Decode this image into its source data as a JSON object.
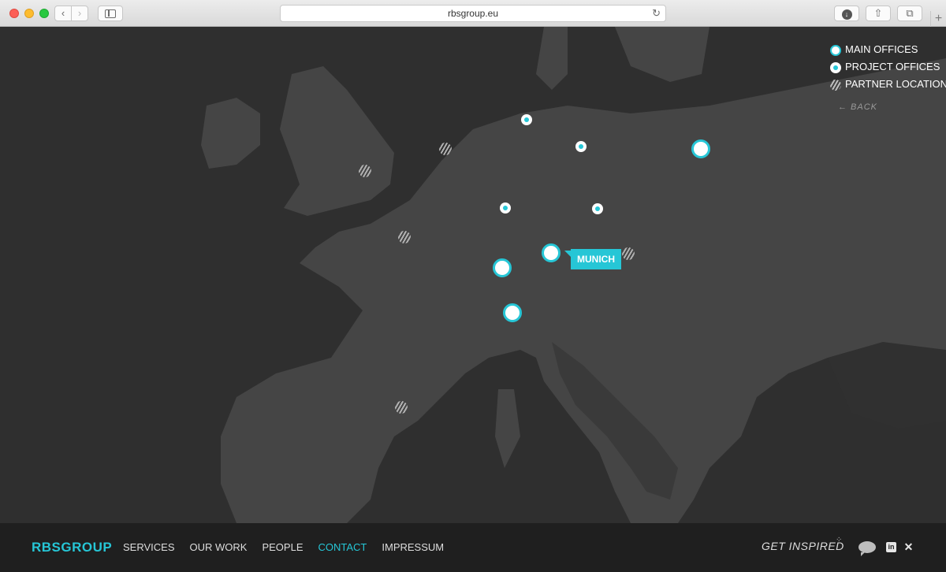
{
  "browser": {
    "url": "rbsgroup.eu",
    "back_glyph": "‹",
    "forward_glyph": "›",
    "reload_glyph": "↻",
    "share_glyph": "⇧",
    "tabs_glyph": "⧉",
    "newtab_glyph": "+"
  },
  "map": {
    "legend": {
      "main_offices": "MAIN OFFICES",
      "project_offices": "PROJECT OFFICES",
      "partner_locations": "PARTNER LOCATIONS"
    },
    "back_label": "← BACK",
    "selected_tooltip": "MUNICH",
    "colors": {
      "accent": "#26c6d6",
      "land": "#444444",
      "sea": "#2f2f2f"
    }
  },
  "footer": {
    "brand": "RBSGROUP",
    "nav": [
      "SERVICES",
      "OUR WORK",
      "PEOPLE",
      "CONTACT",
      "IMPRESSUM"
    ],
    "active_nav": "CONTACT",
    "get_inspired": "GET INSPIRED",
    "linkedin_glyph": "in",
    "xing_glyph": "✕"
  }
}
